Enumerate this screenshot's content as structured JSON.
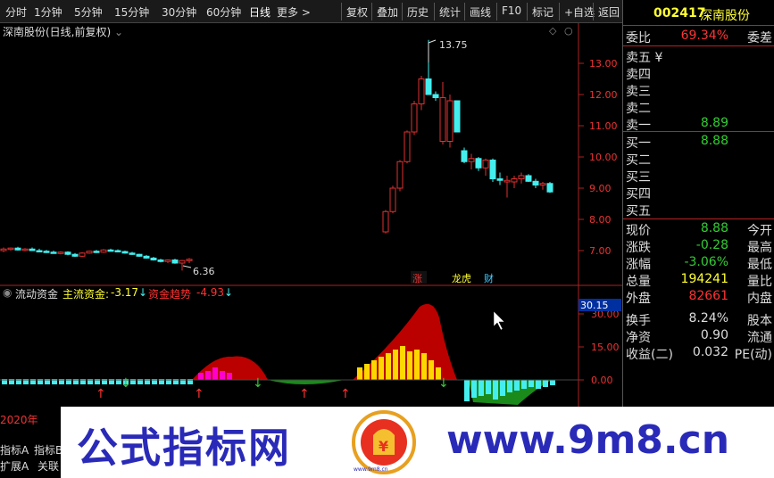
{
  "topbar": {
    "periods": [
      "分时",
      "1分钟",
      "5分钟",
      "15分钟",
      "30分钟",
      "60分钟",
      "日线",
      "更多 >"
    ],
    "tools": [
      "复权",
      "叠加",
      "历史",
      "统计",
      "画线",
      "F10",
      "标记",
      "+自选",
      "返回"
    ]
  },
  "chart": {
    "title": "深南股份(日线,前复权)",
    "high_label": "13.75",
    "low_label": "6.36",
    "price_axis": [
      "13.00",
      "12.00",
      "11.00",
      "10.00",
      "9.00",
      "8.00",
      "7.00"
    ],
    "badges": [
      "涨",
      "龙虎",
      "财"
    ]
  },
  "indicator": {
    "name": "流动资金",
    "main_label": "主流资金:",
    "main_value": "-3.17",
    "trend_label": "资金趋势",
    "trend_value": "-4.93",
    "cursor_value": "30.15",
    "axis": [
      "30.00",
      "15.00",
      "0.00"
    ]
  },
  "bottom_left": {
    "year": "2020年",
    "tab1": "指标A",
    "tab2": "指标B",
    "tab3": "扩展A",
    "tab4": "关联"
  },
  "quote": {
    "code": "002417",
    "name": "深南股份",
    "weibi_label": "委比",
    "weibi_value": "69.34%",
    "weicha_label": "委差",
    "sell": [
      {
        "label": "卖五",
        "price": "¥",
        "vol": ""
      },
      {
        "label": "卖四",
        "price": "",
        "vol": ""
      },
      {
        "label": "卖三",
        "price": "",
        "vol": ""
      },
      {
        "label": "卖二",
        "price": "",
        "vol": ""
      },
      {
        "label": "卖一",
        "price": "8.89",
        "vol": ""
      }
    ],
    "buy": [
      {
        "label": "买一",
        "price": "8.88",
        "vol": ""
      },
      {
        "label": "买二",
        "price": "",
        "vol": ""
      },
      {
        "label": "买三",
        "price": "",
        "vol": ""
      },
      {
        "label": "买四",
        "price": "",
        "vol": ""
      },
      {
        "label": "买五",
        "price": "",
        "vol": ""
      }
    ],
    "stats": [
      {
        "l": "现价",
        "v": "8.88",
        "r": "今开",
        "c": "#3c3"
      },
      {
        "l": "涨跌",
        "v": "-0.28",
        "r": "最高",
        "c": "#3c3"
      },
      {
        "l": "涨幅",
        "v": "-3.06%",
        "r": "最低",
        "c": "#3c3"
      },
      {
        "l": "总量",
        "v": "194241",
        "r": "量比",
        "c": "#ff3"
      },
      {
        "l": "外盘",
        "v": "82661",
        "r": "内盘",
        "c": "#f33"
      },
      {
        "l": "换手",
        "v": "8.24%",
        "r": "股本",
        "c": "#ddd"
      },
      {
        "l": "净资",
        "v": "0.90",
        "r": "流通",
        "c": "#ddd"
      },
      {
        "l": "收益(二)",
        "v": "0.032",
        "r": "PE(动)",
        "c": "#ddd"
      }
    ]
  },
  "watermark": {
    "left": "公式指标网",
    "right": "www.9m8.cn",
    "logo_text": "www.9m8.cn"
  },
  "colors": {
    "up": "#e03030",
    "down": "#4ee",
    "red_area": "#b00",
    "green_area": "#1a8a1a",
    "yellow_bar": "#ffd700",
    "brand": "#2a2ab8"
  }
}
